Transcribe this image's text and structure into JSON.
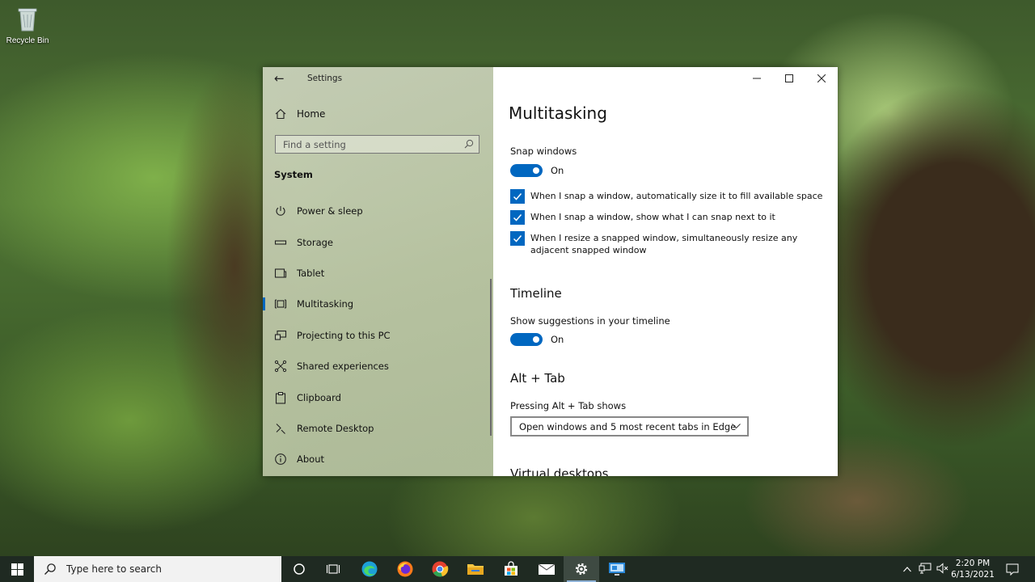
{
  "desktop": {
    "recycle_bin_label": "Recycle Bin"
  },
  "window": {
    "app_title": "Settings",
    "controls": {
      "minimize": "minimize",
      "maximize": "maximize",
      "close": "close"
    }
  },
  "sidebar": {
    "home_label": "Home",
    "search_placeholder": "Find a setting",
    "section_label": "System",
    "items": [
      {
        "label": "Power & sleep",
        "icon": "power-icon"
      },
      {
        "label": "Storage",
        "icon": "storage-icon"
      },
      {
        "label": "Tablet",
        "icon": "tablet-icon"
      },
      {
        "label": "Multitasking",
        "icon": "multitasking-icon",
        "active": true
      },
      {
        "label": "Projecting to this PC",
        "icon": "projecting-icon"
      },
      {
        "label": "Shared experiences",
        "icon": "shared-experiences-icon"
      },
      {
        "label": "Clipboard",
        "icon": "clipboard-icon"
      },
      {
        "label": "Remote Desktop",
        "icon": "remote-desktop-icon"
      },
      {
        "label": "About",
        "icon": "info-icon"
      }
    ]
  },
  "content": {
    "title": "Multitasking",
    "snap": {
      "label": "Snap windows",
      "toggle_state": "On",
      "options": [
        {
          "label": "When I snap a window, automatically size it to fill available space",
          "checked": true
        },
        {
          "label": "When I snap a window, show what I can snap next to it",
          "checked": true
        },
        {
          "label": "When I resize a snapped window, simultaneously resize any adjacent snapped window",
          "checked": true
        }
      ]
    },
    "timeline": {
      "heading": "Timeline",
      "label": "Show suggestions in your timeline",
      "toggle_state": "On"
    },
    "alt_tab": {
      "heading": "Alt + Tab",
      "label": "Pressing Alt + Tab shows",
      "selected": "Open windows and 5 most recent tabs in Edge"
    },
    "next_heading": "Virtual desktops"
  },
  "taskbar": {
    "search_placeholder": "Type here to search",
    "clock_time": "2:20 PM",
    "clock_date": "6/13/2021"
  },
  "colors": {
    "accent": "#0067c0",
    "taskbar": "#1f2a22"
  }
}
